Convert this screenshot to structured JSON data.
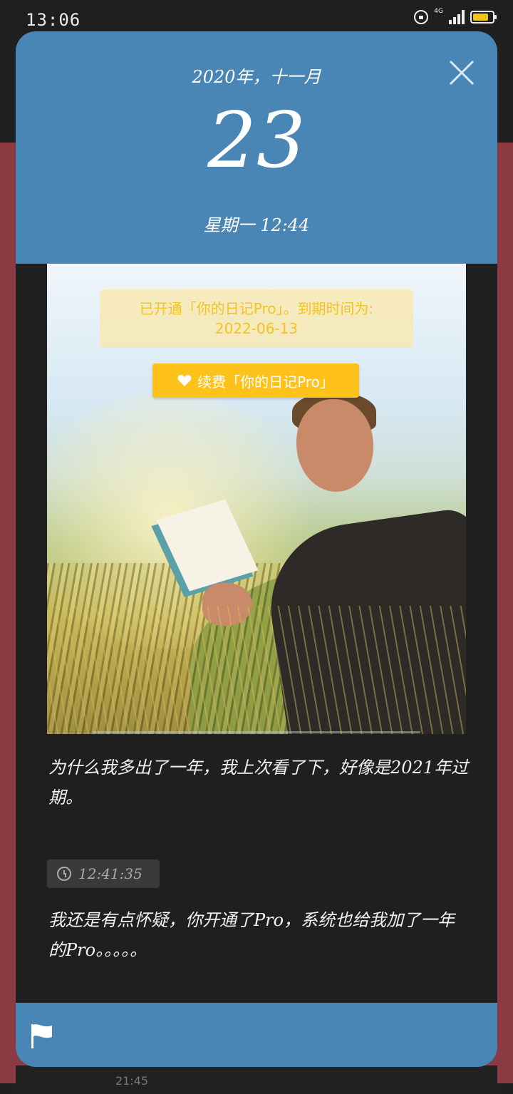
{
  "status_bar": {
    "time": "13:06",
    "network": "4G",
    "battery_color": "#f0c419"
  },
  "header": {
    "month": "2020年，十一月",
    "day": "23",
    "weekday_time": "星期一 12:44",
    "close_icon": "close-icon",
    "color": "#4a86b5"
  },
  "photo": {
    "pro_notice_line1": "已开通「你的日记Pro」。到期时间为:",
    "pro_notice_line2": "2022-06-13",
    "renew_label": "续费「你的日记Pro」",
    "renew_icon": "heart-icon"
  },
  "entries": [
    {
      "text": "为什么我多出了一年，我上次看了下，好像是2021年过期。"
    },
    {
      "time": "12:41:35",
      "text": "我还是有点怀疑，你开通了Pro，系统也给我加了一年的Pro。。。。。"
    }
  ],
  "footer": {
    "flag_icon": "flag-icon"
  },
  "background_peek": {
    "time": "21:45"
  }
}
